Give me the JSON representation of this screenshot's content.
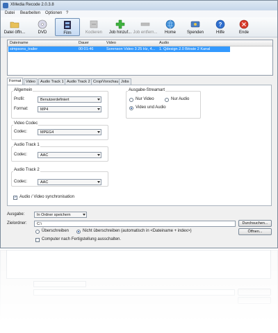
{
  "window": {
    "title": "XMedia Recode 2.0.3.8"
  },
  "menu": [
    "Datei",
    "Bearbeiten",
    "Optionen",
    "?"
  ],
  "toolbar": [
    {
      "label": "Datei öffn...",
      "icon": "folder-icon",
      "enabled": true,
      "active": false
    },
    {
      "label": "DVD",
      "icon": "dvd-disc-icon",
      "enabled": true,
      "active": false
    },
    {
      "label": "Film",
      "icon": "film-strip-icon",
      "enabled": true,
      "active": true
    },
    {
      "label": "Kodieren",
      "icon": "encode-icon",
      "enabled": false,
      "active": false
    },
    {
      "label": "Job hinzuf...",
      "icon": "add-plus-icon",
      "enabled": true,
      "active": false
    },
    {
      "label": "Job entfern...",
      "icon": "remove-minus-icon",
      "enabled": false,
      "active": false
    },
    {
      "label": "Home",
      "icon": "globe-home-icon",
      "enabled": true,
      "active": false
    },
    {
      "label": "Spenden",
      "icon": "donate-icon",
      "enabled": true,
      "active": false
    },
    {
      "label": "Hilfe",
      "icon": "help-question-icon",
      "enabled": true,
      "active": false
    },
    {
      "label": "Ende",
      "icon": "exit-close-icon",
      "enabled": true,
      "active": false
    }
  ],
  "filelist": {
    "columns": [
      "Dateiname",
      "Dauer",
      "Video",
      "Audio"
    ],
    "rows": [
      {
        "name": "simpsons_trailer",
        "duration": "00:01:46",
        "video": "Sorenson Video 3 25 Hz, 4...",
        "audio": "1. Qdesign 2.0 Bitrate 2 Kanal"
      }
    ]
  },
  "tabs": [
    "Format",
    "Video",
    "Audio Track 1",
    "Audio Track 2",
    "Crop/Vorschau",
    "Jobs"
  ],
  "format": {
    "allgemein": {
      "title": "Allgemein",
      "profil_label": "Profil:",
      "profil_value": "Benutzerdefiniert",
      "format_label": "Format:",
      "format_value": "MP4"
    },
    "video_codec": {
      "title": "Video Codec",
      "codec_label": "Codec:",
      "codec_value": "MPEG4"
    },
    "audio1": {
      "title": "Audio Track 1",
      "codec_label": "Codec:",
      "codec_value": "AAC"
    },
    "audio2": {
      "title": "Audio Track 2",
      "codec_label": "Codec:",
      "codec_value": "AAC"
    },
    "sync_label": "Audio / Video synchronisation",
    "sync_checked": true,
    "streamart": {
      "title": "Ausgabe-Streamart",
      "options": [
        "Nur Video",
        "Nur Audio",
        "Video und Audio"
      ],
      "selected": "Video und Audio"
    }
  },
  "output": {
    "ausgabe_label": "Ausgabe:",
    "ausgabe_value": "In Ordner speichern",
    "zielordner_label": "Zielordner:",
    "zielordner_value": "C:\\",
    "browse_button": "Durchsuchen...",
    "open_button": "Öffnen...",
    "overwrite_label": "Überschreiben",
    "no_overwrite_label": "Nicht überschreiben (automatisch in <Dateiname + index>)",
    "overwrite_selected": "no_overwrite",
    "shutdown_label": "Computer nach Fertigstellung ausschalten.",
    "shutdown_checked": false
  }
}
